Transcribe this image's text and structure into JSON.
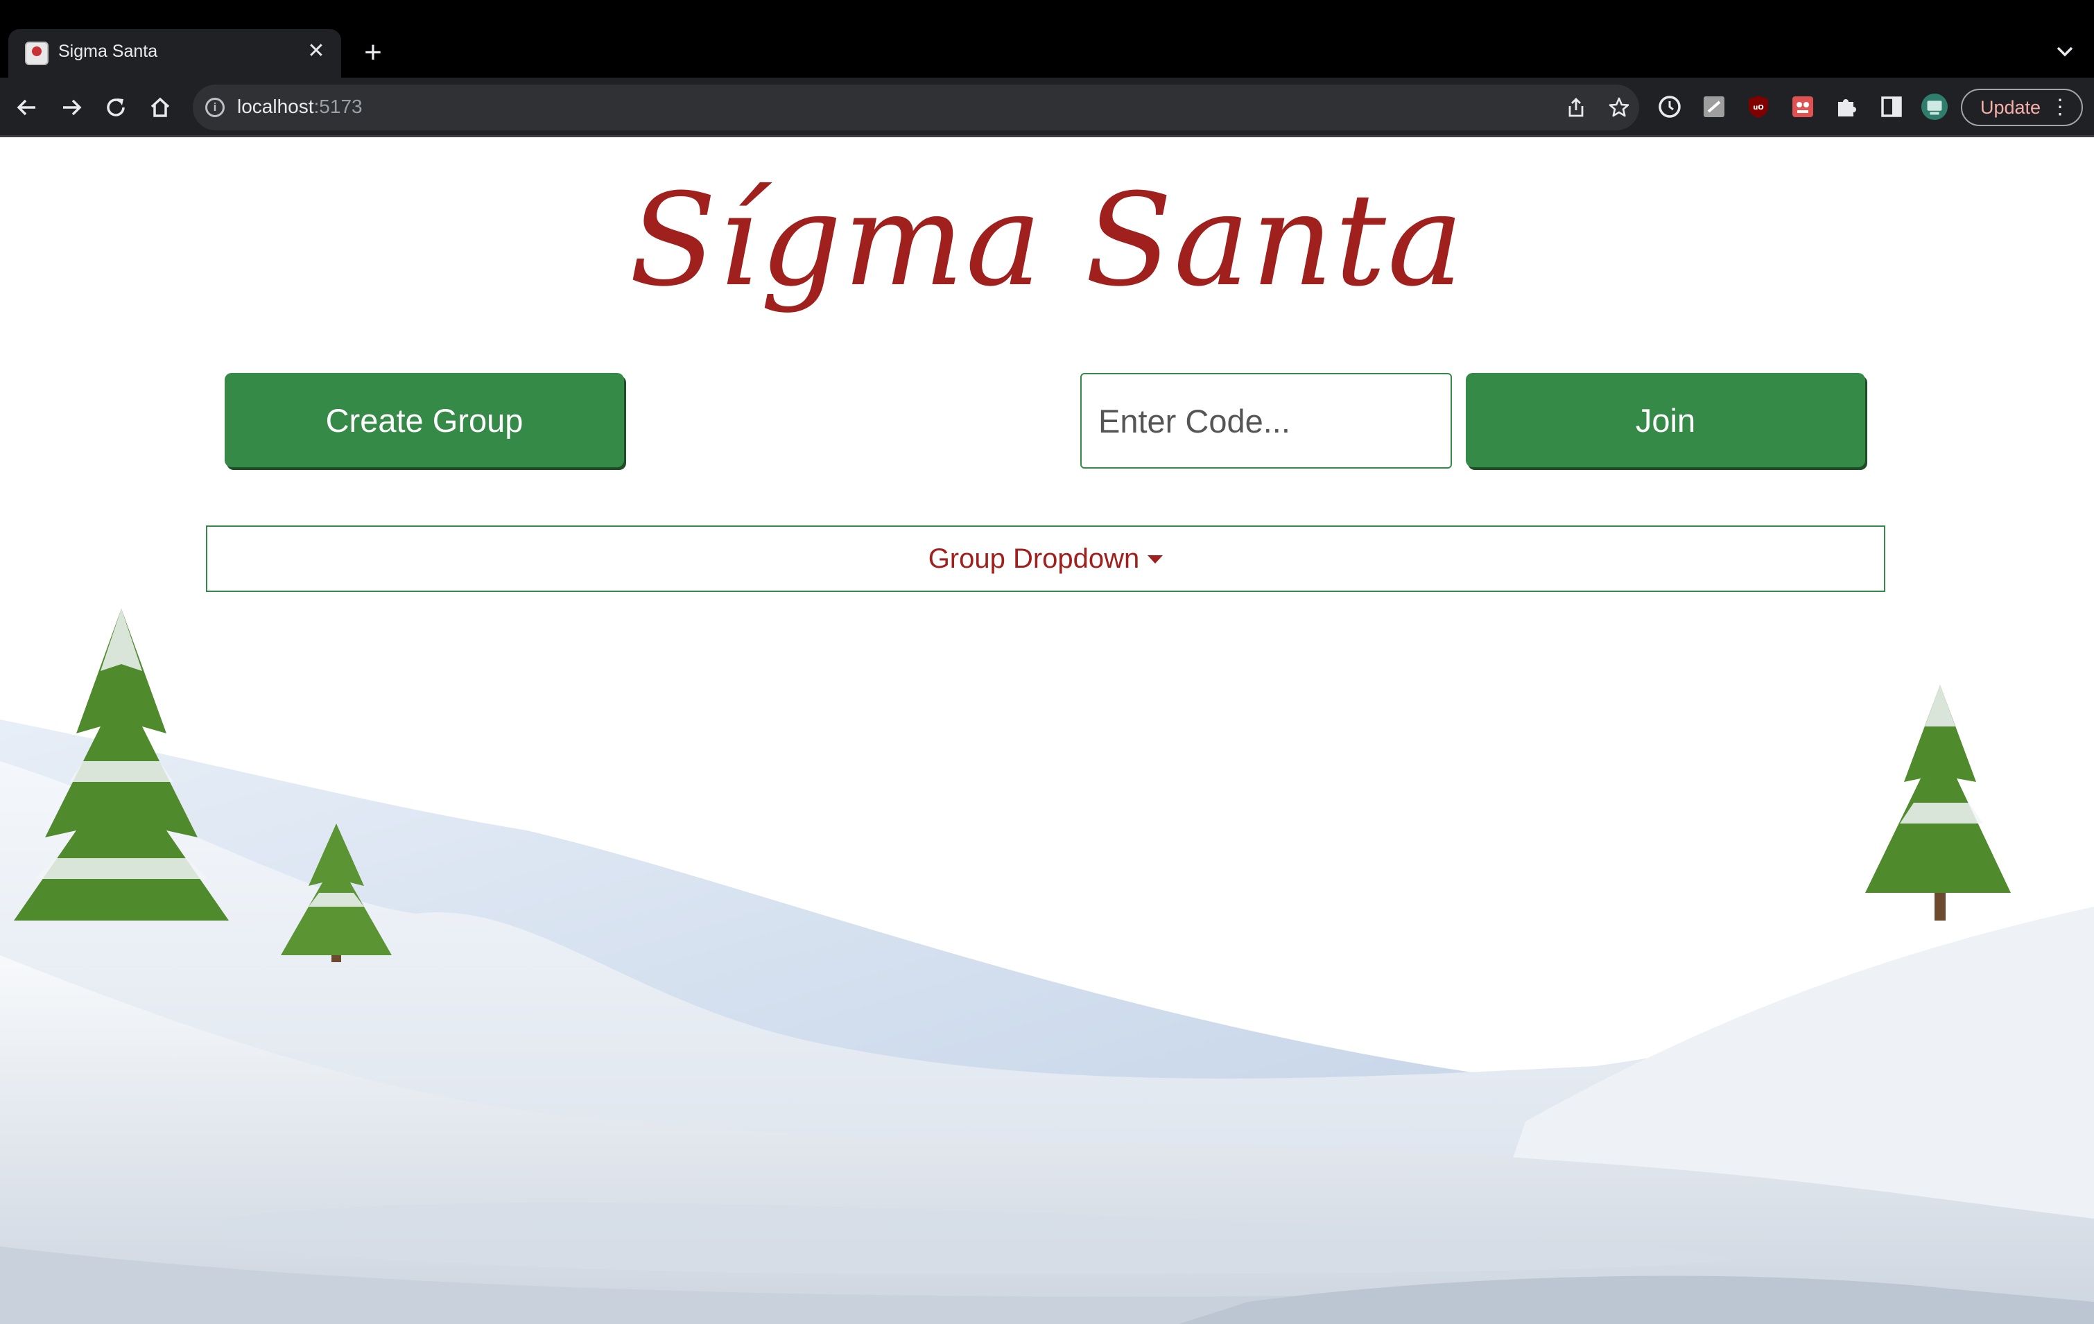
{
  "browser": {
    "tab_title": "Sigma Santa",
    "url_host": "localhost",
    "url_port": ":5173",
    "update_label": "Update"
  },
  "app": {
    "title": "Sígma Santa",
    "create_group_label": "Create Group",
    "code_placeholder": "Enter Code...",
    "join_label": "Join",
    "group_dropdown_label": "Group Dropdown"
  },
  "colors": {
    "accent_green": "#368a47",
    "title_red": "#a0201d"
  }
}
